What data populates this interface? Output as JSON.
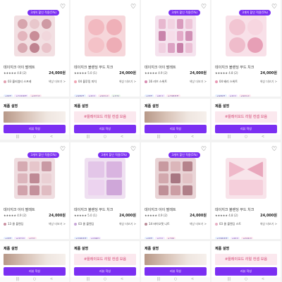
{
  "common": {
    "heart_icon": "♡",
    "promo_label": "3개이 할인 적용(5%)",
    "price": "24,000원",
    "option_more": "색상 더보기 >",
    "desc_title": "제품 설명",
    "cta_label": "리뷰 작성",
    "banner_text": "#플레이모드 리얼 컨셉 모음",
    "nav_icons": [
      "|||",
      "○",
      "<"
    ]
  },
  "panels": [
    {
      "promo": true,
      "name": "데이지크 아이 팔레트",
      "rating": "★★★★★ 4.8 (2)",
      "option": "03 블러썸티 스프레",
      "option_color": "#e2a0b0",
      "tags": [
        "#웜톤",
        "#가을웜톤",
        "#데일리"
      ],
      "banner_type": "face",
      "palette": {
        "bg": "#f2dfe2",
        "layout": "c3",
        "pans": [
          "#d7a5ad",
          "#e8c7cc",
          "#cf9aa4",
          "#e3b5bd",
          "#c98d98",
          "#f1d7dc",
          "#d9a8b1",
          "#bf8390",
          "#e9c2c9"
        ]
      }
    },
    {
      "promo": false,
      "name": "데이지크 블렌딩 무드 치크",
      "rating": "★★★★★ 5.0 (1)",
      "option": "04 블루밍 피치",
      "option_color": "#f0a6b4",
      "tags": [
        "#봄웜톤",
        "#핑크",
        "#블러셔",
        "#추천"
      ],
      "banner_type": "text",
      "palette": {
        "bg": "#f6d6da",
        "layout": "c2",
        "pans": [
          "#f2b9c0",
          "#efb0b8",
          "#f4c2c8",
          "#eeadb6"
        ]
      }
    },
    {
      "promo": true,
      "name": "데이지크 아이 팔레트",
      "rating": "★★★★★ 4.9 (2)",
      "option": "16 러브 스위트",
      "option_color": "#d68ab0",
      "tags": [
        "#쿨톤",
        "#핑크",
        "#여름쿨톤"
      ],
      "banner_type": "face",
      "palette": {
        "bg": "#f5e3ee",
        "layout": "s4",
        "pans": [
          "#e7b7cf",
          "#f2d3e2",
          "#d99bbd",
          "#edc4d8",
          "#c984ab",
          "#f6dde9",
          "#e3aac8",
          "#d190b5",
          "#f0cfe0",
          "#dca2c3",
          "#c77fa8",
          "#ebbfd5"
        ]
      }
    },
    {
      "promo": true,
      "name": "데이지크 블렌딩 무드 치크",
      "rating": "★★★★★ 4.8 (2)",
      "option": "04 베리 스위트",
      "option_color": "#e899b4",
      "tags": [
        "#봄웜톤",
        "#핑크",
        "#블러셔"
      ],
      "banner_type": "text",
      "palette": {
        "bg": "#f8e0e8",
        "layout": "c2",
        "pans": [
          "#f2c5d2",
          "#f7d6e0",
          "#efbccb",
          "#e79fb6"
        ]
      }
    },
    {
      "promo": true,
      "name": "데이지크 아이 팔레트",
      "rating": "★★★★★ 4.9 (2)",
      "option": "13 쿨 블렌딩",
      "option_color": "#c98fa0",
      "tags": [
        "#쿨톤",
        "#데일리",
        "#뮤트"
      ],
      "banner_type": "face",
      "palette": {
        "bg": "#efdde0",
        "layout": "s3",
        "pans": [
          "#d5aab2",
          "#e6c6cb",
          "#c99aa4",
          "#dcb5bc",
          "#bf8a95",
          "#ead0d4",
          "#d1a2ab",
          "#c4919c",
          "#e0bcc2"
        ]
      }
    },
    {
      "promo": true,
      "name": "데이지크 블렌딩 무드 치크",
      "rating": "★★★★★ 5.0 (1)",
      "option": "03 쿨 블렌딩",
      "option_color": "#c8a6d8",
      "tags": [
        "#여름쿨톤",
        "#라벤더"
      ],
      "banner_type": "text",
      "palette": {
        "bg": "#efe0f1",
        "layout": "s2",
        "pans": [
          "#e3c6e8",
          "#d9b4e0",
          "#ecd3ef",
          "#cfa7d9"
        ]
      }
    },
    {
      "promo": true,
      "name": "데이지크 아이 팔레트",
      "rating": "★★★★★ 4.9 (2)",
      "option": "14 바이오렛 니트",
      "option_color": "#b98a96",
      "tags": [
        "#쿨톤",
        "#뮤트",
        "#가을"
      ],
      "banner_type": "face",
      "palette": {
        "bg": "#e9d4d6",
        "layout": "s3",
        "pans": [
          "#c89aa0",
          "#dbb6ba",
          "#b5848c",
          "#d2a8ad",
          "#a87782",
          "#e3c3c6",
          "#bf8f97",
          "#cc9ea4",
          "#b07f88"
        ]
      }
    },
    {
      "promo": false,
      "name": "데이지크 블렌딩 무드 치크",
      "rating": "★★★★★ 4.8 (2)",
      "option": "03 쿨 블렌딩 스트",
      "option_color": "#e8b0c4",
      "tags": [
        "#여름쿨톤",
        "#핑크",
        "#러블리"
      ],
      "banner_type": "text",
      "palette": {
        "bg": "#f8e4ea",
        "layout": "bow",
        "pans": [
          "#efb8c9",
          "#f5cfdb",
          "#e9a7bc"
        ]
      }
    }
  ],
  "tag_colors": [
    "#e6f0ff",
    "#f5e8ff",
    "#ffe8f0",
    "#eaf7ea"
  ]
}
